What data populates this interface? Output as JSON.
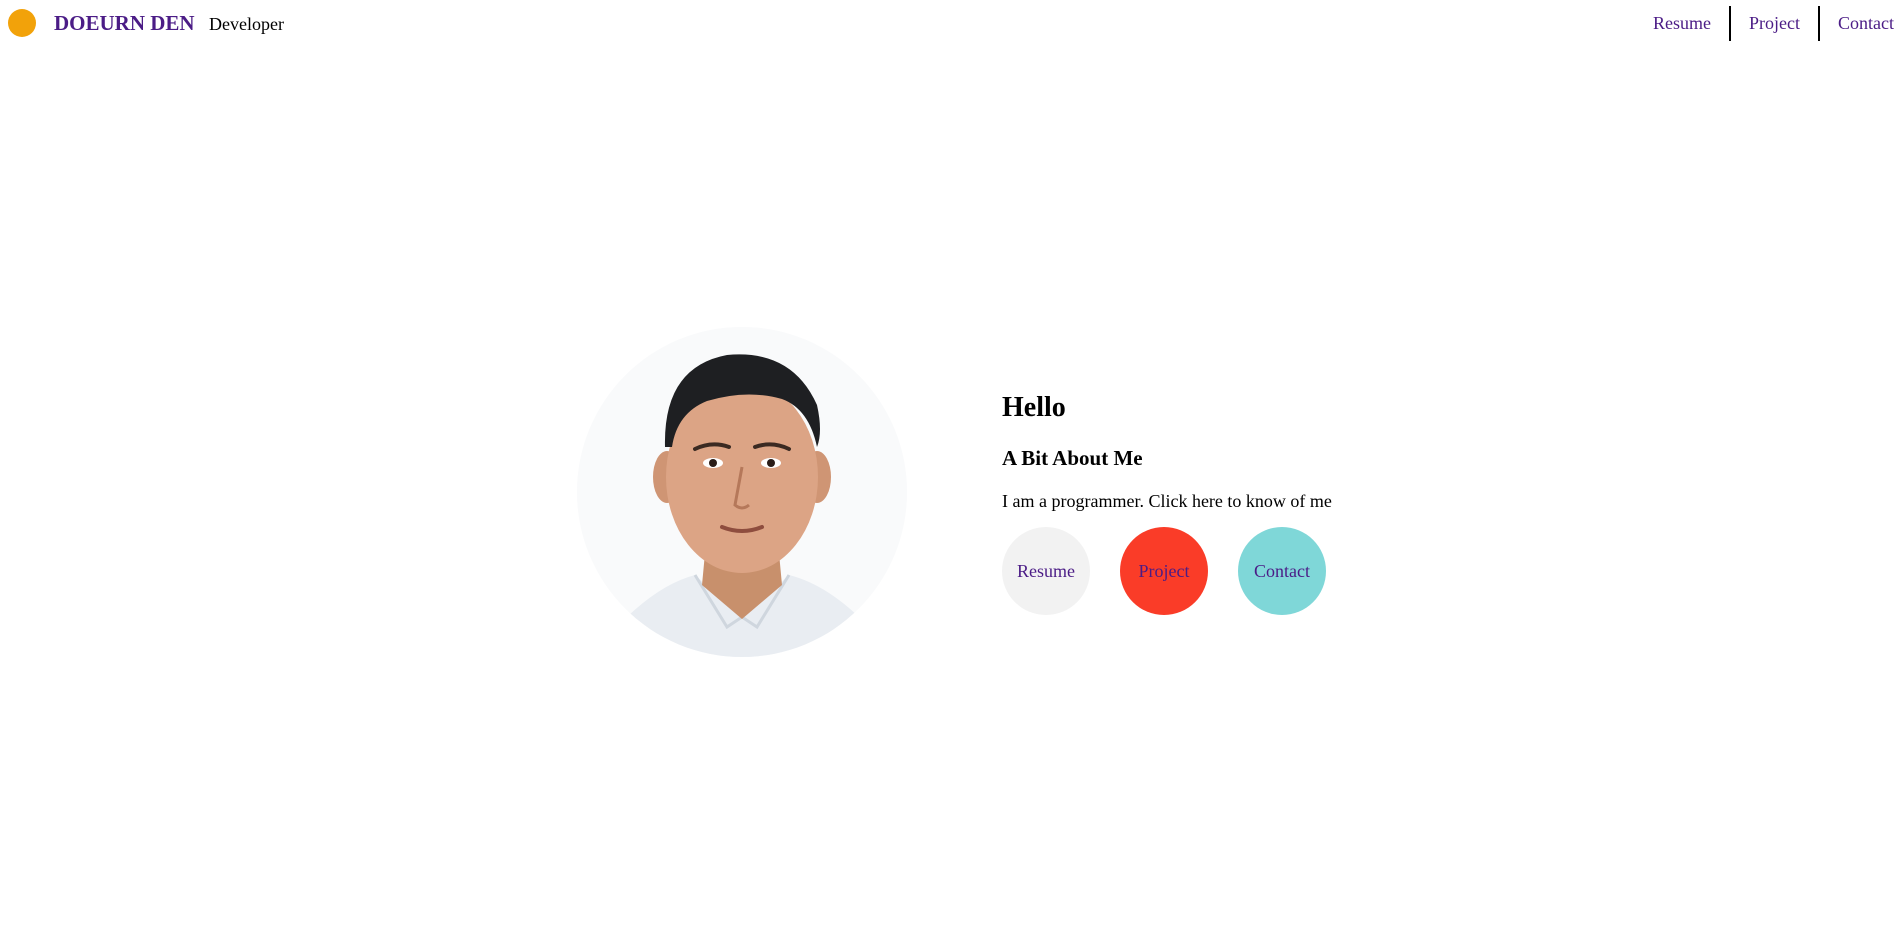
{
  "header": {
    "brand_name": "DOEURN DEN",
    "brand_role": "Developer",
    "logo_color": "#f2a20a",
    "nav": [
      {
        "label": "Resume"
      },
      {
        "label": "Project"
      },
      {
        "label": "Contact"
      }
    ]
  },
  "hero": {
    "title": "Hello",
    "subtitle": "A Bit About Me",
    "text": "I am a programmer. Click here to know of me",
    "buttons": [
      {
        "label": "Resume",
        "color": "#f2f2f2"
      },
      {
        "label": "Project",
        "color": "#fa3c28"
      },
      {
        "label": "Contact",
        "color": "#7fd7d8"
      }
    ]
  },
  "colors": {
    "brand_purple": "#4b1c86",
    "link_purple": "#4b1c86",
    "text": "#000000"
  },
  "icons": {
    "logo": "orange-circle-logo-icon"
  }
}
